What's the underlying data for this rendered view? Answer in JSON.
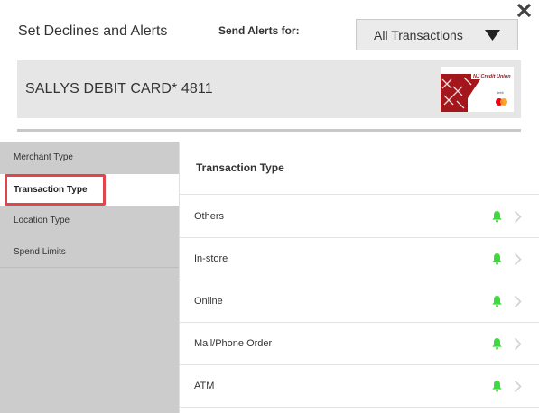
{
  "dialog": {
    "title": "Set Declines and Alerts",
    "alerts_label": "Send Alerts for:",
    "alerts_select_value": "All Transactions"
  },
  "card": {
    "name": "SALLYS DEBIT CARD* 4811",
    "brand_text": "NJ Credit Union",
    "network": "mastercard",
    "debit_text": "debit"
  },
  "left_nav": {
    "items": [
      {
        "label": "Merchant Type"
      },
      {
        "label": "Transaction Type"
      },
      {
        "label": "Location Type"
      },
      {
        "label": "Spend Limits"
      }
    ]
  },
  "panel": {
    "title": "Transaction Type",
    "rows": [
      {
        "label": "Others"
      },
      {
        "label": "In-store"
      },
      {
        "label": "Online"
      },
      {
        "label": "Mail/Phone Order"
      },
      {
        "label": "ATM"
      }
    ]
  },
  "colors": {
    "bell": "#3fd93f",
    "highlight": "#e0474c",
    "card_red": "#a3161c"
  }
}
